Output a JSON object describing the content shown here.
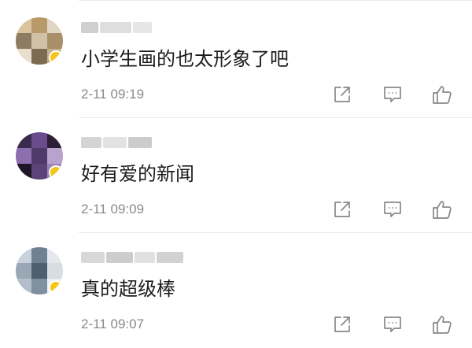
{
  "comments": [
    {
      "username": "blurred user 1",
      "text": "小学生画的也太形象了吧",
      "time": "2-11 09:19",
      "avatar_colors": [
        "#d9c49c",
        "#b89a6a",
        "#e0d6c4",
        "#8e7c62",
        "#cfc2a8",
        "#a98f68",
        "#e8dfcf",
        "#7d6b4f",
        "#c4b08a"
      ]
    },
    {
      "username": "blurred user 2",
      "text": "好有爱的新闻",
      "time": "2-11 09:09",
      "avatar_colors": [
        "#3a2a4e",
        "#6a4b8c",
        "#2b1e36",
        "#8d6fb0",
        "#4f3a6b",
        "#b7a3cc",
        "#1f1628",
        "#5c4479",
        "#9a86b6"
      ]
    },
    {
      "username": "blurred user 3",
      "text": "真的超级棒",
      "time": "2-11 09:07",
      "avatar_colors": [
        "#c8d2dc",
        "#6f8294",
        "#e4e8ec",
        "#9aa8b6",
        "#4e5f70",
        "#d6dde3",
        "#b2bfcb",
        "#7f90a0",
        "#edf0f2"
      ]
    }
  ],
  "icons": {
    "share": "share-icon",
    "reply": "comment-icon",
    "like": "thumbs-up-icon"
  },
  "colors": {
    "icon": "#888888",
    "timestamp": "#8a8a8a",
    "text": "#1c1c1c",
    "badge": "#f5c518"
  }
}
